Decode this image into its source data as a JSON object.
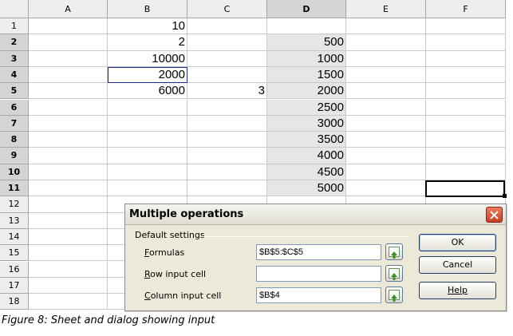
{
  "sheet": {
    "columns": [
      "A",
      "B",
      "C",
      "D",
      "E",
      "F"
    ],
    "selected_column": "D",
    "rows": [
      "1",
      "2",
      "3",
      "4",
      "5",
      "6",
      "7",
      "8",
      "9",
      "10",
      "11",
      "12",
      "13",
      "14",
      "15",
      "16",
      "17",
      "18"
    ],
    "selected_rows": [
      "2",
      "3",
      "4",
      "5",
      "6",
      "7",
      "8",
      "9",
      "10",
      "11"
    ],
    "cells": {
      "B1": "10",
      "B2": "2",
      "B3": "10000",
      "B4": "2000",
      "B5": "6000",
      "C5": "3",
      "D2": "500",
      "D3": "1000",
      "D4": "1500",
      "D5": "2000",
      "D6": "2500",
      "D7": "3000",
      "D8": "3500",
      "D9": "4000",
      "D10": "4500",
      "D11": "5000"
    },
    "cursor_cell": "B4",
    "active_cell": "F11"
  },
  "dialog": {
    "title": "Multiple operations",
    "group_label": "Default settings",
    "fields": [
      {
        "label": "Formulas",
        "accel": "F",
        "value": "$B$5:$C$5"
      },
      {
        "label": "Row input cell",
        "accel": "R",
        "value": ""
      },
      {
        "label": "Column input cell",
        "accel": "C",
        "value": "$B$4"
      }
    ],
    "buttons": {
      "ok": "OK",
      "cancel": "Cancel",
      "help": "Help"
    },
    "icons": {
      "close": "close-icon",
      "shrink": "shrink-icon"
    }
  },
  "caption": "Figure 8: Sheet and dialog showing input"
}
